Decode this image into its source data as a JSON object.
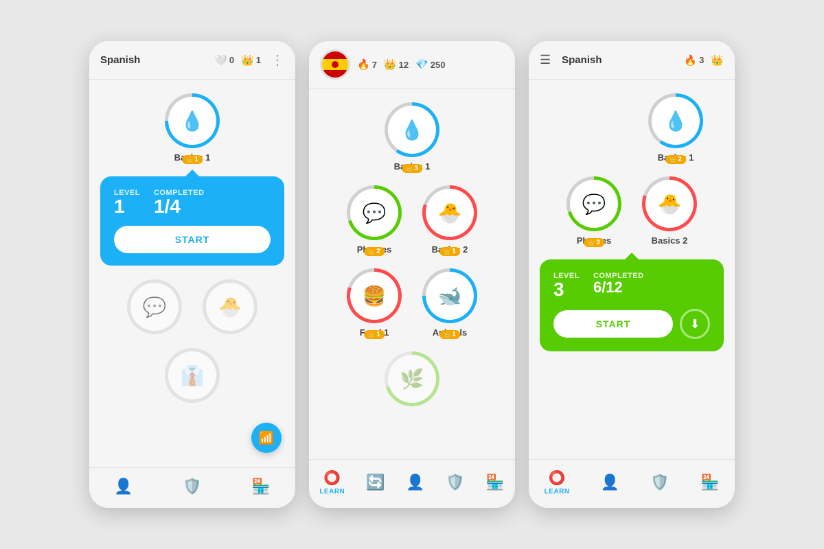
{
  "phone1": {
    "header": {
      "title": "Spanish",
      "hearts_count": "0",
      "crown_count": "1",
      "menu_dots": "⋮"
    },
    "basics1": {
      "label": "Basics 1",
      "crown_level": "1"
    },
    "popup": {
      "color": "blue",
      "level_label": "Level",
      "level_value": "1",
      "completed_label": "Completed",
      "completed_value": "1/4",
      "start_label": "START"
    },
    "nav": [
      {
        "icon": "👤",
        "label": ""
      },
      {
        "icon": "🛡",
        "label": ""
      },
      {
        "icon": "🏪",
        "label": ""
      }
    ]
  },
  "phone2": {
    "header": {
      "flag": true,
      "fire_count": "7",
      "crown_count": "12",
      "gem_count": "250"
    },
    "skills": [
      {
        "id": "basics1",
        "label": "Basics 1",
        "crown": "3",
        "color": "blue",
        "icon": "💧"
      },
      {
        "id": "phrases",
        "label": "Phrases",
        "crown": "2",
        "color": "green",
        "icon": "💬"
      },
      {
        "id": "basics2",
        "label": "Basics 2",
        "crown": "1",
        "color": "red",
        "icon": "🐣"
      },
      {
        "id": "food1",
        "label": "Food 1",
        "crown": "1",
        "color": "red",
        "icon": "🍔"
      },
      {
        "id": "animals",
        "label": "Animals",
        "crown": "1",
        "color": "blue",
        "icon": "🐋"
      }
    ],
    "nav": [
      {
        "icon": "learn",
        "label": "LEARN",
        "active": true
      },
      {
        "icon": "heart",
        "label": ""
      },
      {
        "icon": "person",
        "label": ""
      },
      {
        "icon": "shield",
        "label": ""
      },
      {
        "icon": "shop",
        "label": ""
      }
    ]
  },
  "phone3": {
    "header": {
      "hamburger": "☰",
      "title": "Spanish",
      "fire_count": "3",
      "crown_icon": "👑"
    },
    "skills": [
      {
        "id": "basics1",
        "label": "Basics 1",
        "crown": "2",
        "color": "blue",
        "icon": "💧"
      },
      {
        "id": "phrases",
        "label": "Phrases",
        "crown": "3",
        "color": "green",
        "icon": "💬"
      },
      {
        "id": "basics2",
        "label": "Basics 2",
        "crown": "",
        "color": "red",
        "icon": "🐣"
      }
    ],
    "popup": {
      "color": "green",
      "level_label": "Level",
      "level_value": "3",
      "completed_label": "Completed",
      "completed_value": "6/12",
      "start_label": "START"
    },
    "nav": [
      {
        "icon": "learn",
        "label": "Learn",
        "active": true
      },
      {
        "icon": "person",
        "label": ""
      },
      {
        "icon": "shield",
        "label": ""
      },
      {
        "icon": "shop",
        "label": ""
      }
    ]
  }
}
